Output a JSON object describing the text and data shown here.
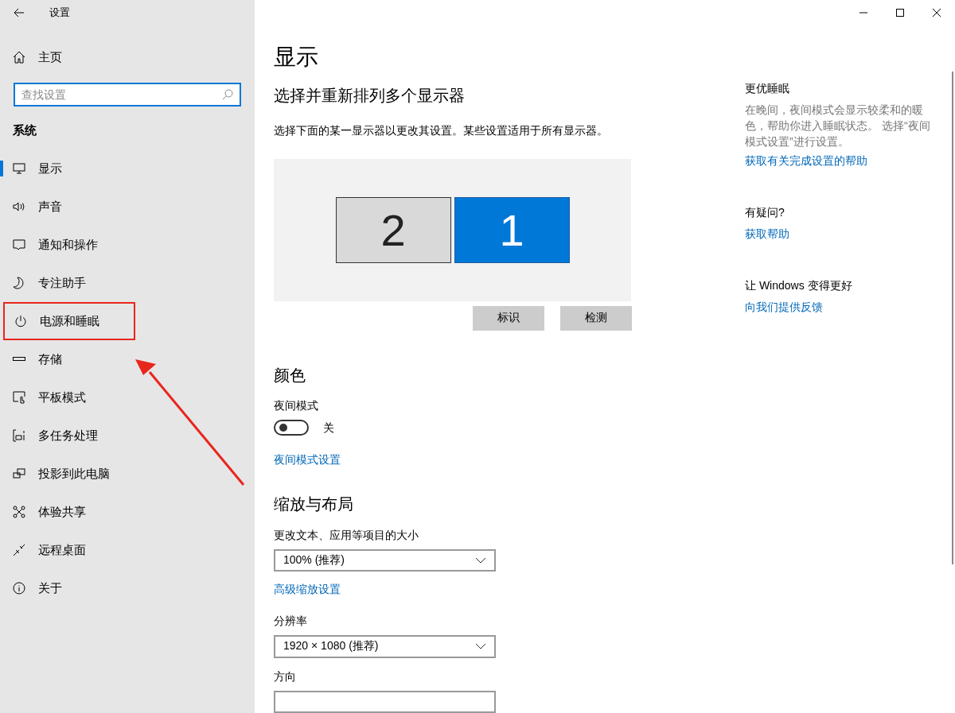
{
  "window": {
    "title": "设置"
  },
  "sidebar": {
    "home": "主页",
    "search": {
      "placeholder": "查找设置"
    },
    "section": "系统",
    "items": [
      {
        "label": "显示",
        "kind": "monitor",
        "selected": true,
        "highlighted": false
      },
      {
        "label": "声音",
        "kind": "speaker",
        "selected": false,
        "highlighted": false
      },
      {
        "label": "通知和操作",
        "kind": "message",
        "selected": false,
        "highlighted": false
      },
      {
        "label": "专注助手",
        "kind": "moon",
        "selected": false,
        "highlighted": false
      },
      {
        "label": "电源和睡眠",
        "kind": "power",
        "selected": false,
        "highlighted": true
      },
      {
        "label": "存储",
        "kind": "drive",
        "selected": false,
        "highlighted": false
      },
      {
        "label": "平板模式",
        "kind": "tablet",
        "selected": false,
        "highlighted": false
      },
      {
        "label": "多任务处理",
        "kind": "multitask",
        "selected": false,
        "highlighted": false
      },
      {
        "label": "投影到此电脑",
        "kind": "project",
        "selected": false,
        "highlighted": false
      },
      {
        "label": "体验共享",
        "kind": "share",
        "selected": false,
        "highlighted": false
      },
      {
        "label": "远程桌面",
        "kind": "remote",
        "selected": false,
        "highlighted": false
      },
      {
        "label": "关于",
        "kind": "info",
        "selected": false,
        "highlighted": false
      }
    ]
  },
  "main": {
    "title": "显示",
    "arrange": {
      "heading": "选择并重新排列多个显示器",
      "description": "选择下面的某一显示器以更改其设置。某些设置适用于所有显示器。",
      "monitors": [
        {
          "label": "2",
          "selected": false
        },
        {
          "label": "1",
          "selected": true
        }
      ],
      "buttons": [
        "标识",
        "检测"
      ]
    },
    "color": {
      "heading": "颜色",
      "night_light": {
        "label": "夜间模式",
        "on": false,
        "state_text": "关"
      },
      "link": "夜间模式设置"
    },
    "scale": {
      "heading": "缩放与布局",
      "text_size": {
        "label": "更改文本、应用等项目的大小",
        "value": "100% (推荐)"
      },
      "link": "高级缩放设置",
      "resolution": {
        "label": "分辨率",
        "value": "1920 × 1080 (推荐)"
      },
      "orientation": {
        "label": "方向"
      }
    }
  },
  "aside": [
    {
      "heading": "更优睡眠",
      "text": "在晚间，夜间模式会显示较柔和的暖色，帮助你进入睡眠状态。 选择“夜间模式设置”进行设置。",
      "link": "获取有关完成设置的帮助"
    },
    {
      "heading": "有疑问?",
      "link": "获取帮助"
    },
    {
      "heading": "让 Windows 变得更好",
      "link": "向我们提供反馈"
    }
  ]
}
